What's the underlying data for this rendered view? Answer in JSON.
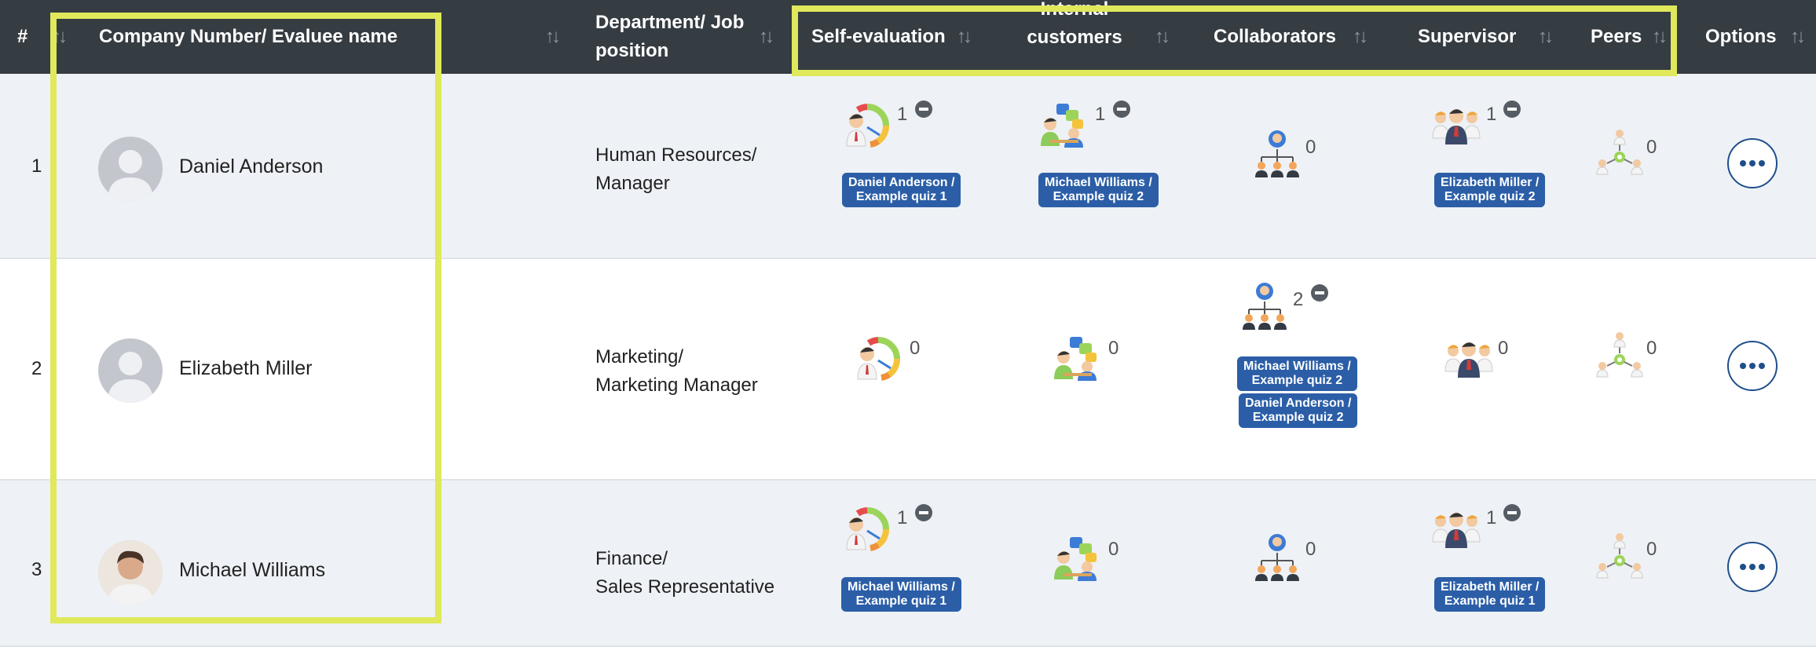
{
  "header": {
    "num": "#",
    "evaluee": "Company Number/ Evaluee name",
    "dept_line1": "Department/ Job",
    "dept_line2": "position",
    "self_eval": "Self-evaluation",
    "internal_line1": "Internal",
    "internal_line2": "customers",
    "collaborators": "Collaborators",
    "supervisor": "Supervisor",
    "peers": "Peers",
    "options": "Options",
    "sort_glyph": "↑↓"
  },
  "rows": [
    {
      "num": "1",
      "name": "Daniel Anderson",
      "dept_line1": "Human Resources/",
      "dept_line2": "Manager",
      "self_count": "1",
      "self_badge_l1": "Daniel Anderson /",
      "self_badge_l2": "Example quiz 1",
      "internal_count": "1",
      "internal_badge_l1": "Michael Williams /",
      "internal_badge_l2": "Example quiz 2",
      "collab_count": "0",
      "sup_count": "1",
      "sup_badge_l1": "Elizabeth Miller /",
      "sup_badge_l2": "Example quiz 2",
      "peers_count": "0"
    },
    {
      "num": "2",
      "name": "Elizabeth Miller",
      "dept_line1": "Marketing/",
      "dept_line2": "Marketing Manager",
      "self_count": "0",
      "internal_count": "0",
      "collab_count": "2",
      "collab_badge1_l1": "Michael Williams /",
      "collab_badge1_l2": "Example quiz 2",
      "collab_badge2_l1": "Daniel Anderson /",
      "collab_badge2_l2": "Example quiz 2",
      "sup_count": "0",
      "peers_count": "0"
    },
    {
      "num": "3",
      "name": "Michael Williams",
      "dept_line1": "Finance/",
      "dept_line2": "Sales Representative",
      "self_count": "1",
      "self_badge_l1": "Michael Williams /",
      "self_badge_l2": "Example quiz 1",
      "internal_count": "0",
      "collab_count": "0",
      "sup_count": "1",
      "sup_badge_l1": "Elizabeth Miller /",
      "sup_badge_l2": "Example quiz 1",
      "peers_count": "0"
    }
  ],
  "colors": {
    "header_bg": "#353c42",
    "badge_bg": "#2b5ea7",
    "highlight": "#dfe95b",
    "options_ring": "#1f4f8a"
  }
}
